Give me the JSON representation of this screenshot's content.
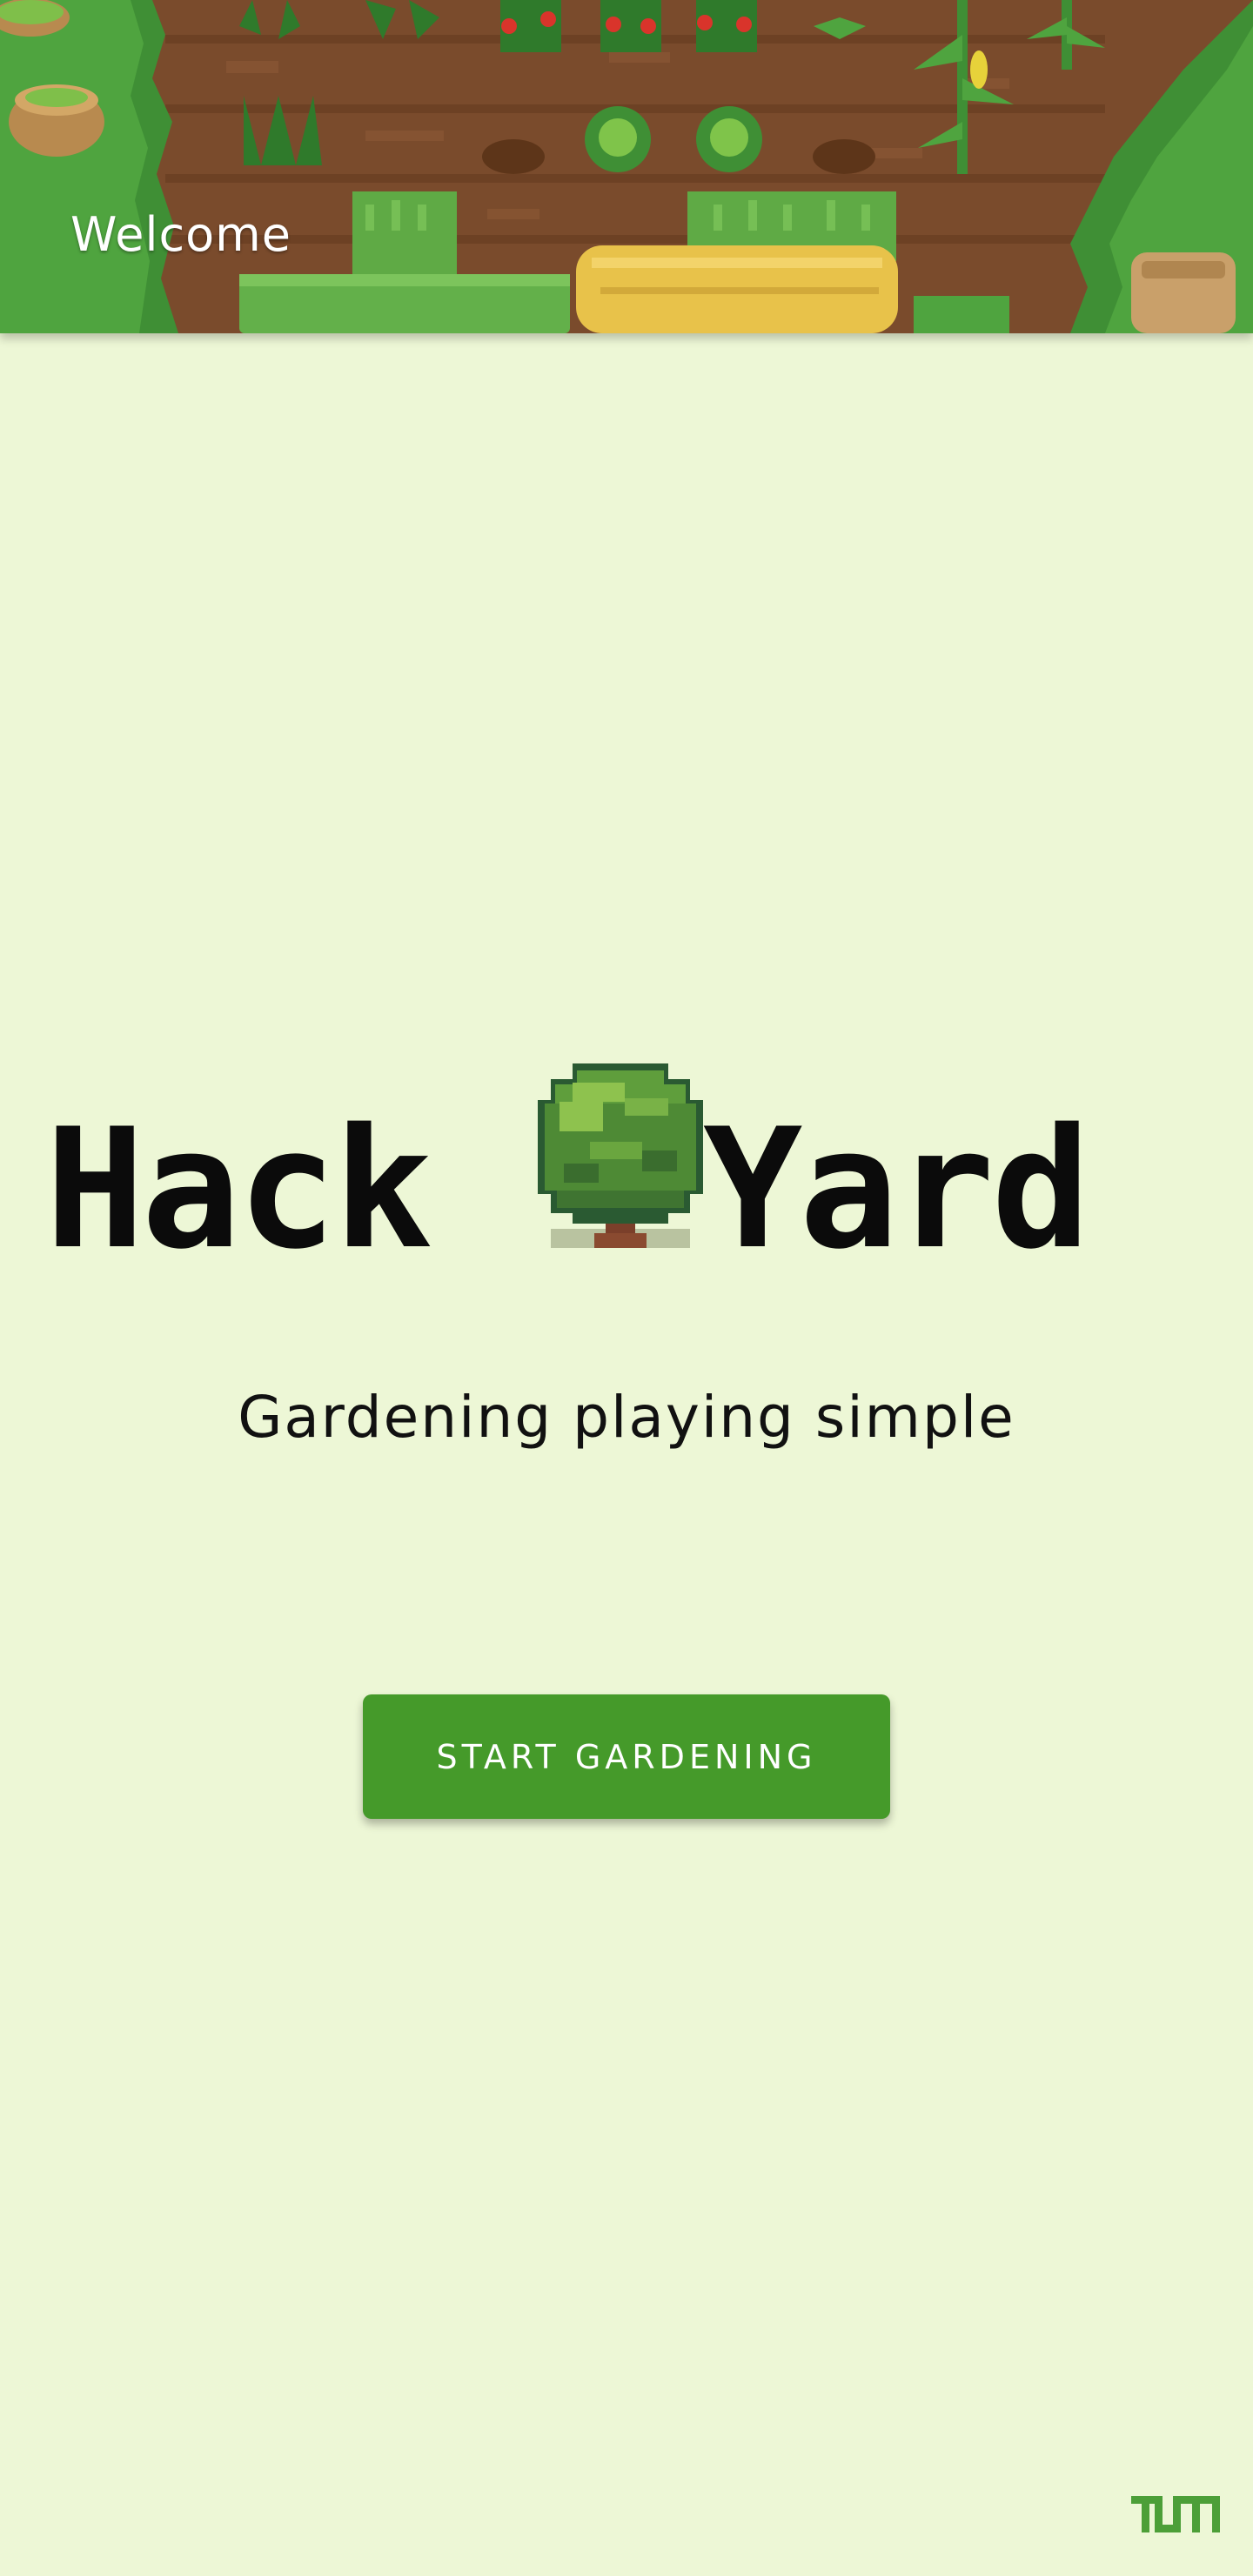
{
  "app": {
    "header_title": "Welcome"
  },
  "logo": {
    "part_left": "Hack",
    "part_right": "Yard",
    "icon": "tree-icon"
  },
  "main": {
    "tagline": "Gardening playing simple",
    "start_button_label": "START GARDENING"
  },
  "footer": {
    "brand_icon": "tum-logo-icon"
  },
  "colors": {
    "background": "#edf7d6",
    "accent": "#459a2a",
    "button_text": "#ffffff",
    "header_text": "#ffffff",
    "soil": "#7a4b2c",
    "grass": "#3f8f35"
  }
}
